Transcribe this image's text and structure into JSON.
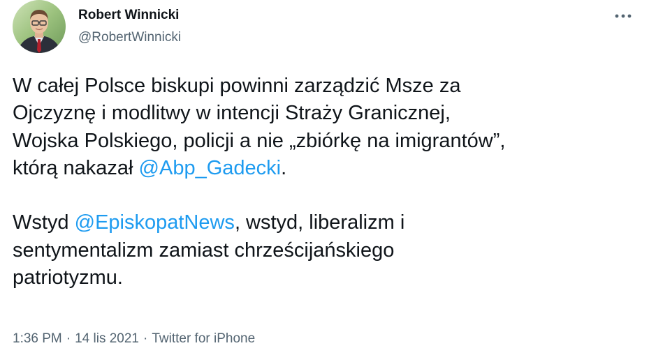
{
  "author": {
    "name": "Robert Winnicki",
    "handle": "@RobertWinnicki"
  },
  "more_icon": "more-horizontal-icon",
  "tweet": {
    "segments": [
      {
        "type": "text",
        "text": "W całej Polsce biskupi powinni zarządzić Msze za\nOjczyznę i modlitwy w intencji Straży Granicznej,\nWojska Polskiego, policji a nie „zbiórkę na imigrantów”,\nktórą nakazał "
      },
      {
        "type": "mention",
        "text": "@Abp_Gadecki"
      },
      {
        "type": "text",
        "text": ".\n\nWstyd "
      },
      {
        "type": "mention",
        "text": "@EpiskopatNews"
      },
      {
        "type": "text",
        "text": ", wstyd, liberalizm i\nsentymentalizm zamiast chrześcijańskiego\npatriotyzmu."
      }
    ]
  },
  "meta": {
    "time": "1:36 PM",
    "separator": "·",
    "date": "14 lis 2021",
    "source": "Twitter for iPhone"
  },
  "colors": {
    "text": "#0f1419",
    "secondary": "#536471",
    "link": "#1d9bf0"
  }
}
